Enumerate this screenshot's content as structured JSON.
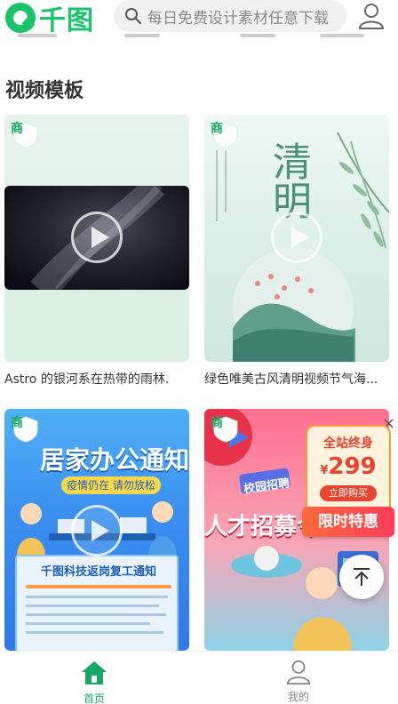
{
  "header": {
    "logo_text": "千图",
    "search_placeholder": "每日免费设计素材任意下载"
  },
  "section": {
    "title": "视频模板"
  },
  "cards": [
    {
      "badge": "商",
      "caption": "Astro 的银河系在热带的雨林."
    },
    {
      "badge": "商",
      "caption": "绿色唯美古风清明视频节气海..."
    },
    {
      "badge": "商",
      "caption": "",
      "poster_title": "居家办公通知",
      "poster_sub": "疫情仍在 请勿放松",
      "poster_box_title": "千图科技返岗复工通知"
    },
    {
      "badge": "商",
      "caption": "",
      "poster_title": "人才招募令",
      "poster_tag": "校园招聘"
    }
  ],
  "qingming": {
    "title": "清明"
  },
  "promo": {
    "top_text": "全站终身",
    "currency": "¥",
    "price": "299",
    "buy_label": "立即购买",
    "ribbon_text": "限时特惠"
  },
  "close_label": "×",
  "bottom_nav": {
    "items": [
      {
        "label": "首页",
        "active": true
      },
      {
        "label": "我的",
        "active": false
      }
    ]
  },
  "colors": {
    "brand": "#17c46a",
    "active_nav": "#17a863",
    "inactive_nav": "#888888",
    "promo_red": "#e8442e"
  },
  "icons": [
    "search-icon",
    "user-icon",
    "play-icon",
    "home-icon",
    "back-to-top-icon",
    "close-icon"
  ]
}
